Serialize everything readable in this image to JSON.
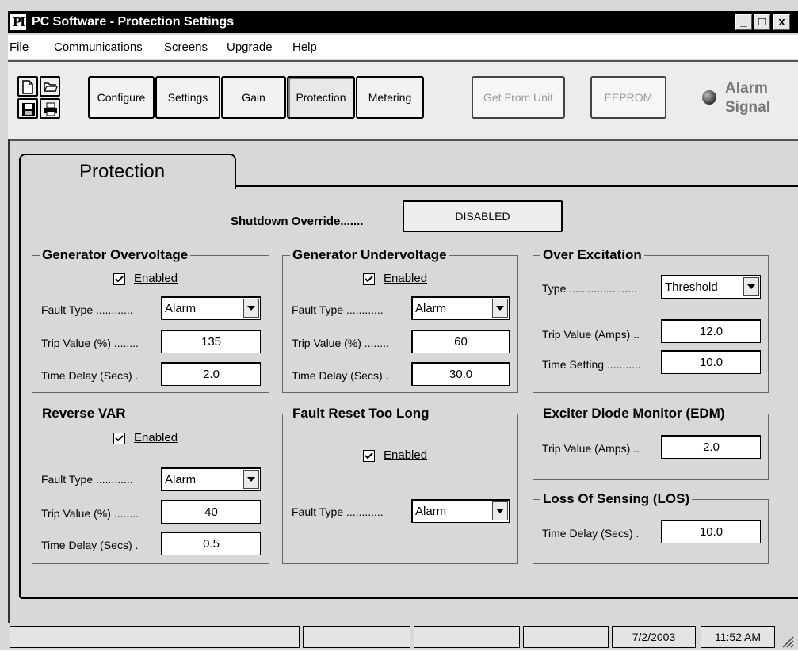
{
  "window": {
    "title": "PC Software - Protection Settings",
    "icon_glyph": "PI",
    "minimize_glyph": "_",
    "maximize_glyph": "□",
    "close_glyph": "x"
  },
  "menu": {
    "file": "File",
    "communications": "Communications",
    "screens": "Screens",
    "upgrade": "Upgrade",
    "help": "Help"
  },
  "toolbar": {
    "icons": [
      "new-file-icon",
      "open-folder-icon",
      "save-disk-icon",
      "print-icon"
    ],
    "configure": "Configure",
    "settings": "Settings",
    "gain": "Gain",
    "protection": "Protection",
    "metering": "Metering",
    "get_from_unit": "Get From Unit",
    "eeprom": "EEPROM",
    "alarm_line1": "Alarm",
    "alarm_line2": "Signal"
  },
  "tab": {
    "label": "Protection"
  },
  "shutdown_override": {
    "label": "Shutdown Override.......",
    "value": "DISABLED"
  },
  "labels": {
    "enabled": "Enabled",
    "fault_type": "Fault Type ............",
    "trip_value_pct": "Trip Value (%) ........",
    "time_delay_secs": "Time Delay (Secs) .",
    "type": "Type ......................",
    "trip_value_amps": "Trip Value (Amps) ..",
    "time_setting": "Time Setting ..........."
  },
  "generator_overvoltage": {
    "title": "Generator Overvoltage",
    "enabled": true,
    "fault_type": "Alarm",
    "trip_value": "135",
    "time_delay": "2.0"
  },
  "generator_undervoltage": {
    "title": "Generator Undervoltage",
    "enabled": true,
    "fault_type": "Alarm",
    "trip_value": "60",
    "time_delay": "30.0"
  },
  "over_excitation": {
    "title": "Over Excitation",
    "type": "Threshold",
    "trip_value": "12.0",
    "time_setting": "10.0"
  },
  "reverse_var": {
    "title": "Reverse VAR",
    "enabled": true,
    "fault_type": "Alarm",
    "trip_value": "40",
    "time_delay": "0.5"
  },
  "fault_reset": {
    "title": "Fault Reset Too Long",
    "enabled": true,
    "fault_type_label": "Fault Type ............",
    "fault_type": "Alarm"
  },
  "edm": {
    "title": "Exciter Diode Monitor (EDM)",
    "trip_value": "2.0"
  },
  "los": {
    "title": "Loss Of Sensing (LOS)",
    "time_delay": "10.0"
  },
  "status": {
    "date": "7/2/2003",
    "time": "11:52 AM"
  }
}
